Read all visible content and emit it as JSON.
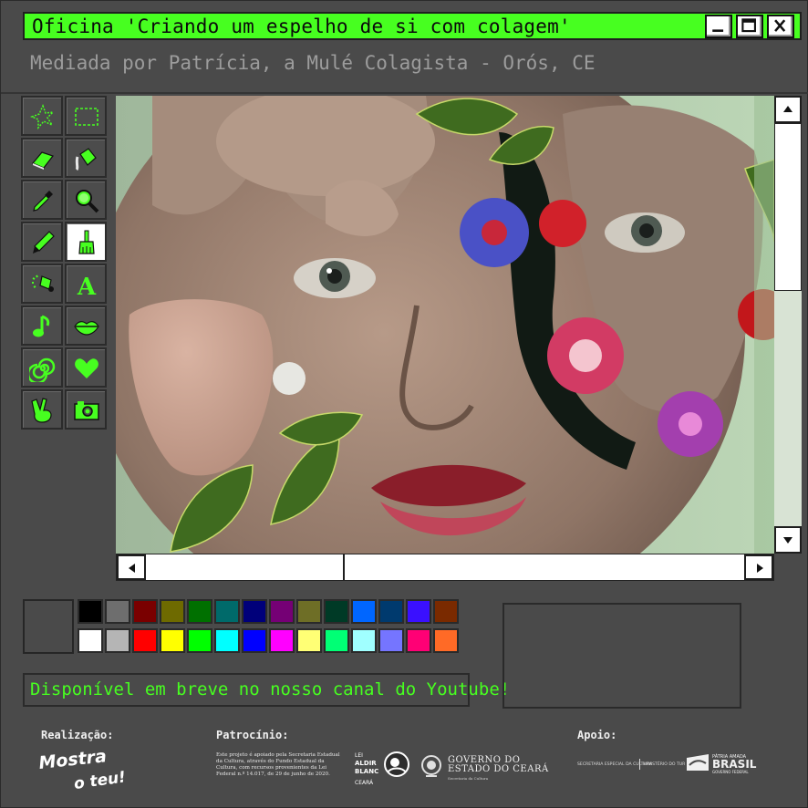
{
  "window": {
    "title": "Oficina 'Criando um espelho de si com colagem'",
    "subtitle": "Mediada por Patrícia, a Mulé Colagista - Orós, CE"
  },
  "colors": {
    "accent": "#47ff20",
    "window_bg": "#4a4a4a",
    "subtitle_text": "#9c9c9c"
  },
  "tools": [
    {
      "name": "free-select-icon",
      "active": false
    },
    {
      "name": "rect-select-icon",
      "active": false
    },
    {
      "name": "eraser-icon",
      "active": false
    },
    {
      "name": "fill-bucket-icon",
      "active": false
    },
    {
      "name": "eyedropper-icon",
      "active": false
    },
    {
      "name": "magnifier-icon",
      "active": false
    },
    {
      "name": "pencil-icon",
      "active": false
    },
    {
      "name": "brush-icon",
      "active": true
    },
    {
      "name": "airbrush-icon",
      "active": false
    },
    {
      "name": "text-icon",
      "active": false
    },
    {
      "name": "music-note-icon",
      "active": false
    },
    {
      "name": "lips-icon",
      "active": false
    },
    {
      "name": "spiral-icon",
      "active": false
    },
    {
      "name": "heart-icon",
      "active": false
    },
    {
      "name": "peace-hand-icon",
      "active": false
    },
    {
      "name": "camera-icon",
      "active": false
    }
  ],
  "tool_labels": {
    "text_tool_glyph": "A"
  },
  "palette": {
    "top_row": [
      "#000000",
      "#6e6e6e",
      "#7a0000",
      "#6e6a00",
      "#007000",
      "#006a6a",
      "#00007a",
      "#750075",
      "#6e6e26",
      "#003a26",
      "#0066ff",
      "#003a6e",
      "#3a10ff",
      "#7a2a00"
    ],
    "bottom_row": [
      "#ffffff",
      "#b5b5b5",
      "#ff0000",
      "#ffff00",
      "#00ff00",
      "#00ffff",
      "#0000ff",
      "#ff00ff",
      "#ffff75",
      "#00ff75",
      "#a0ffff",
      "#7575ff",
      "#ff0075",
      "#ff6a26"
    ]
  },
  "status": {
    "message": "Disponível em breve no nosso canal do Youtube!"
  },
  "footer": {
    "realizacao_label": "Realização:",
    "patrocinio_label": "Patrocínio:",
    "apoio_label": "Apoio:",
    "mostra_logo_line1": "Mostra",
    "mostra_logo_line2": "o teu!",
    "sponsor_note": "Este projeto é apoiado pela Secretaria Estadual da Cultura, através do Fundo Estadual da Cultura, com recursos provenientes da Lei Federal n.º 14.017, de 29 de junho de 2020.",
    "aldir_logo": [
      "LEI",
      "ALDIR",
      "BLANC",
      "CEARÁ"
    ],
    "ceara_logo_line1": "GOVERNO DO",
    "ceara_logo_line2": "ESTADO DO CEARÁ",
    "ceara_logo_sub": "Secretaria da Cultura",
    "apoio_secretaria": "SECRETARIA ESPECIAL DA CULTURA",
    "apoio_ministerio": "MINISTÉRIO DO TURISMO",
    "brasil_top": "PÁTRIA AMADA",
    "brasil_main": "BRASIL",
    "brasil_sub": "GOVERNO FEDERAL"
  }
}
